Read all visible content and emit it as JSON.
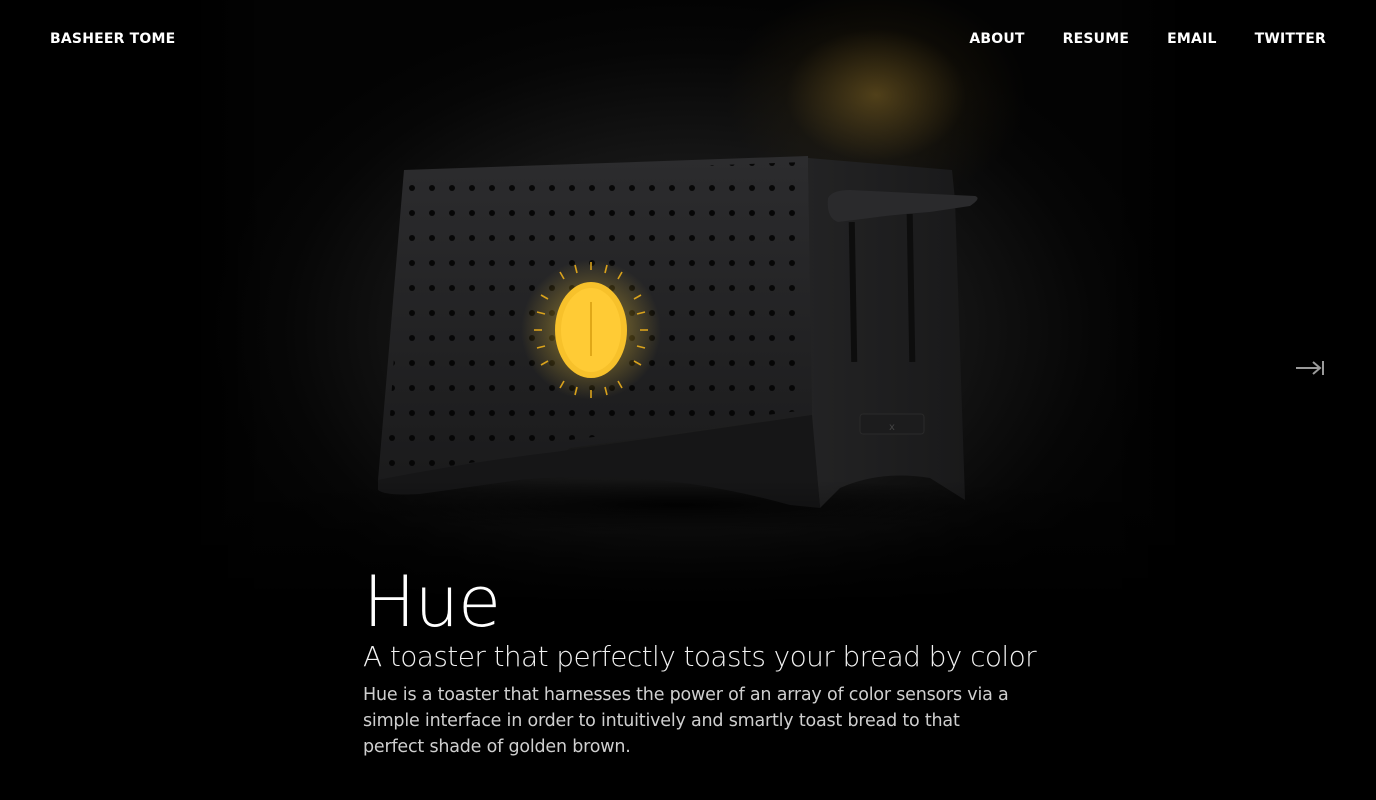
{
  "header": {
    "brand": "BASHEER TOME",
    "nav": [
      "ABOUT",
      "RESUME",
      "EMAIL",
      "TWITTER"
    ]
  },
  "project": {
    "title": "Hue",
    "subtitle": "A toaster that perfectly toasts your bread by color",
    "description": "Hue is a toaster that harnesses the power of an array of color sensors via a simple interface in order to intuitively and smartly toast bread to that perfect shade of golden brown."
  },
  "icons": {
    "next": "arrow-right-to-bar-icon",
    "dial": "sun-dial-icon"
  },
  "colors": {
    "background": "#000000",
    "accent": "#f7c12b",
    "glow": "#8c6e28"
  }
}
